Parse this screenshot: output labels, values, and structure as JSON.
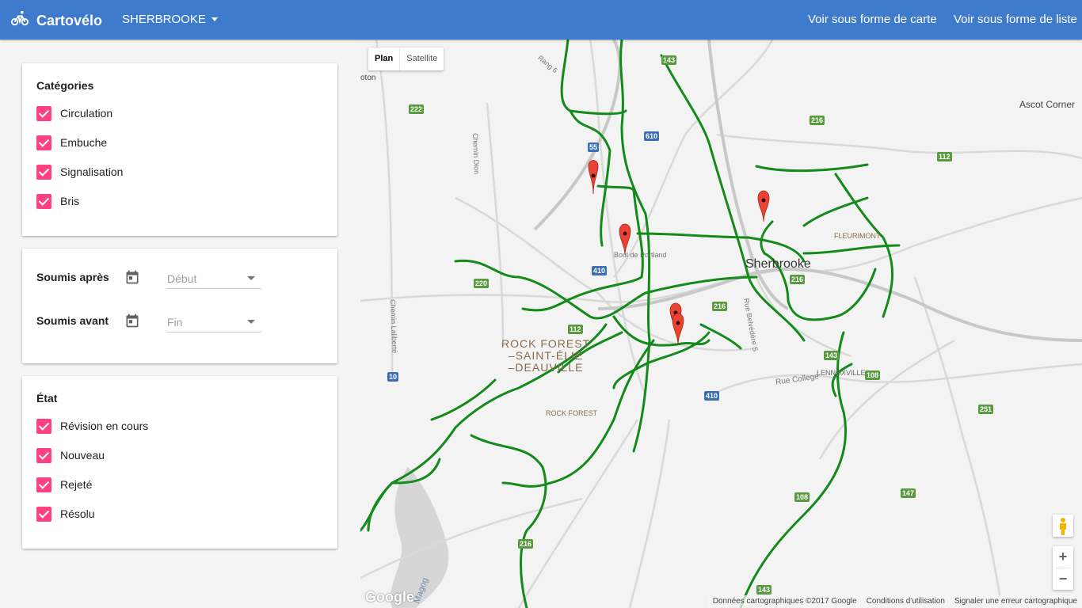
{
  "header": {
    "app_name": "Cartovélo",
    "city": "SHERBROOKE",
    "nav_map": "Voir sous forme de carte",
    "nav_list": "Voir sous forme de liste"
  },
  "categories": {
    "title": "Catégories",
    "items": [
      "Circulation",
      "Embuche",
      "Signalisation",
      "Bris"
    ]
  },
  "dates": {
    "after_label": "Soumis après",
    "after_placeholder": "Début",
    "before_label": "Soumis avant",
    "before_placeholder": "Fin"
  },
  "state": {
    "title": "État",
    "items": [
      "Révision en cours",
      "Nouveau",
      "Rejeté",
      "Résolu"
    ]
  },
  "map": {
    "type_plan": "Plan",
    "type_satellite": "Satellite",
    "zoom_in": "+",
    "zoom_out": "−",
    "google": "Google",
    "attribution": "Données cartographiques ©2017 Google",
    "terms": "Conditions d'utilisation",
    "report": "Signaler une erreur cartographique",
    "labels": {
      "sherbrooke": "Sherbrooke",
      "rock_forest_1": "ROCK FOREST",
      "rock_forest_2": "–SAINT-ÉLIE",
      "rock_forest_3": "–DEAUVILLE",
      "rock_forest_small": "ROCK FOREST",
      "fleurimont": "FLEURIMONT",
      "lennoxville": "LENNOXVILLE",
      "ascot": "Ascot Corner",
      "rue_college": "Rue College",
      "chemin_dion": "Chemin Dion",
      "chemin_laliberte": "Chemin Laliberté",
      "rue_belvedere": "Rue Belvédère S",
      "rue_portland": "Boul de Portland",
      "magog": "Magog",
      "rang": "Rang 6",
      "oton": "oton"
    },
    "shields": [
      "222",
      "220",
      "112",
      "410",
      "610",
      "216",
      "143",
      "108",
      "147",
      "251",
      "10",
      "55",
      "143",
      "112",
      "216",
      "216",
      "410",
      "108",
      "143",
      "216"
    ]
  },
  "colors": {
    "header": "#3f7bcc",
    "checkbox": "#ff4081",
    "bike_path": "#138a1a",
    "marker": "#ea4335"
  }
}
